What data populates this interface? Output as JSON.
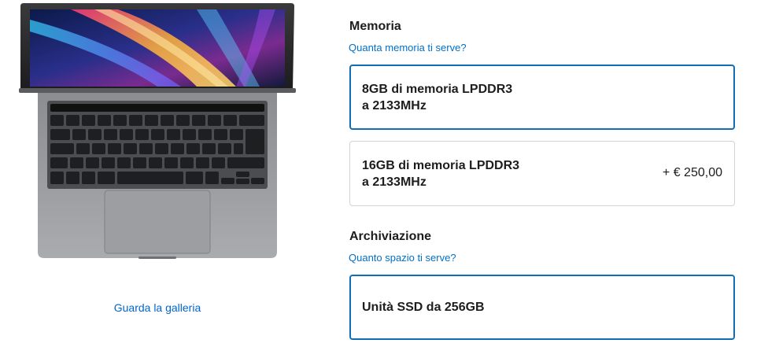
{
  "gallery": {
    "link_label": "Guarda la galleria"
  },
  "memory": {
    "title": "Memoria",
    "help": "Quanta memoria ti serve?",
    "options": [
      {
        "name": "8GB di memoria LPDDR3\na 2133MHz",
        "price": "",
        "selected": true
      },
      {
        "name": "16GB di memoria LPDDR3\na 2133MHz",
        "price": "+ € 250,00",
        "selected": false
      }
    ]
  },
  "storage": {
    "title": "Archiviazione",
    "help": "Quanto spazio ti serve?",
    "options": [
      {
        "name": "Unità SSD da 256GB",
        "price": "",
        "selected": true
      }
    ]
  },
  "colors": {
    "link": "#0070c9",
    "selected_border": "#0f6eb6",
    "unselected_border": "#d2d2d7"
  }
}
